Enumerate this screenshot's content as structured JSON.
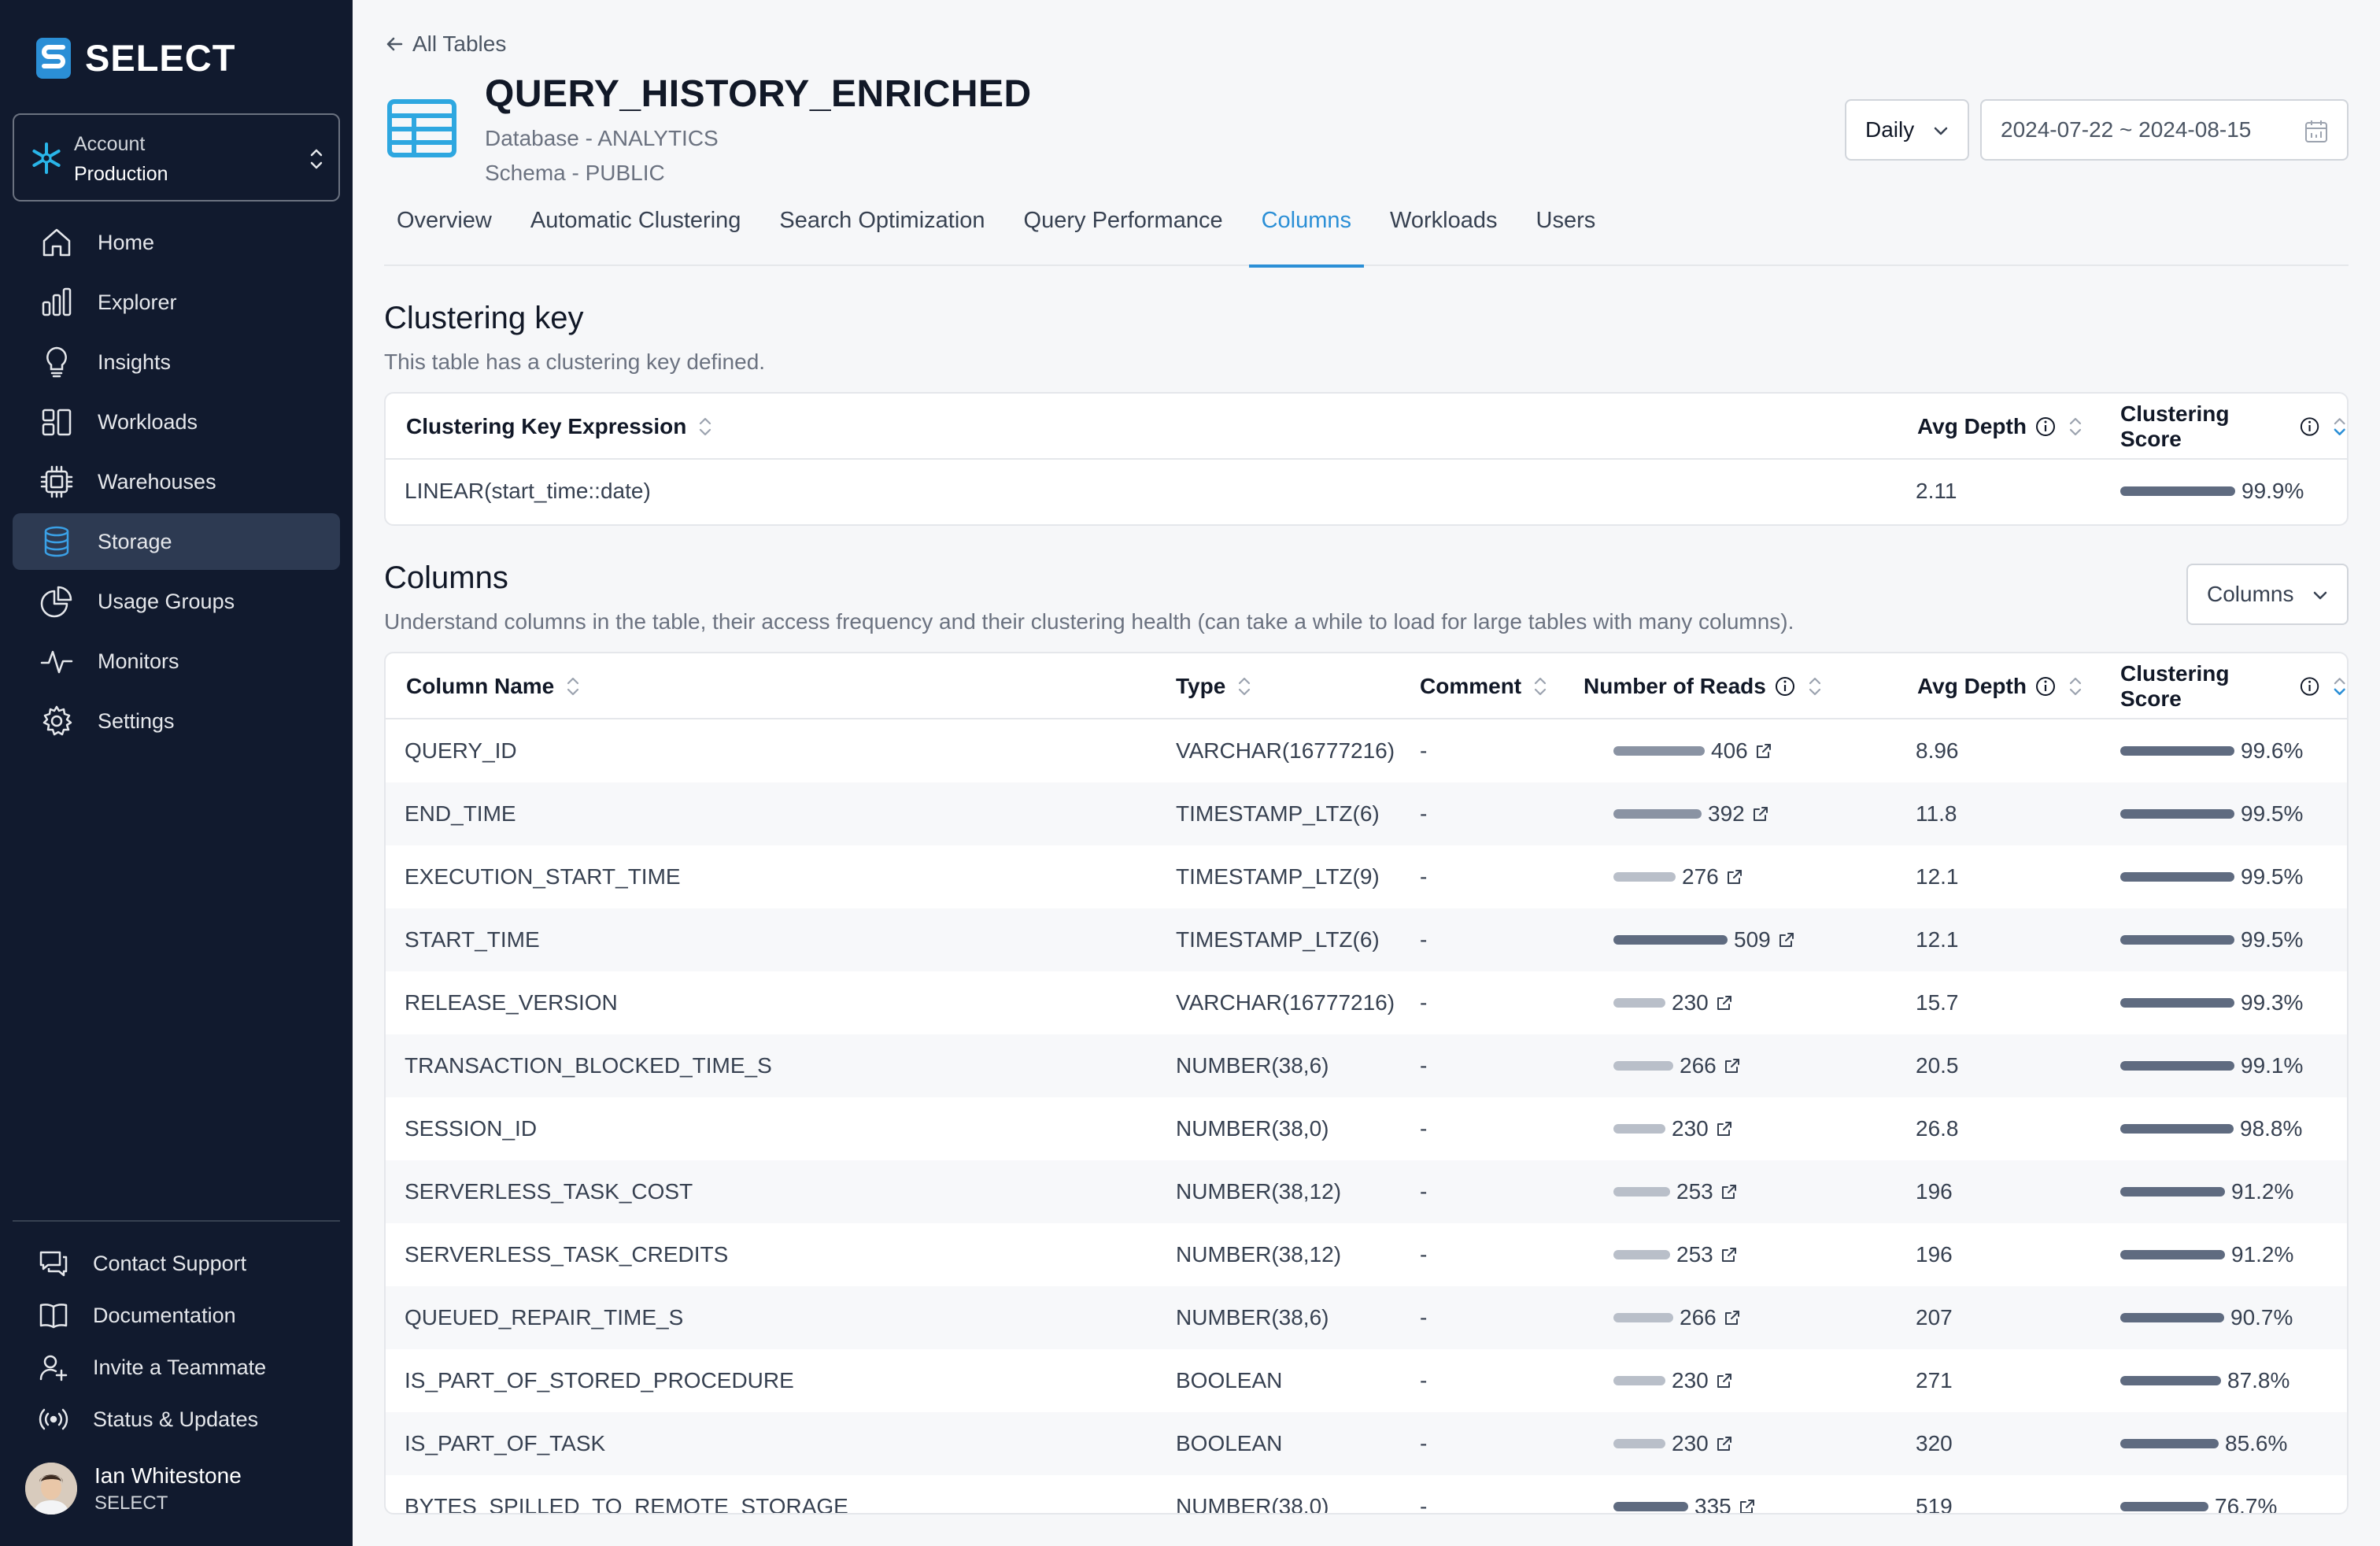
{
  "app": {
    "name": "SELECT"
  },
  "account": {
    "label": "Account",
    "value": "Production"
  },
  "nav": [
    {
      "label": "Home",
      "icon": "home-icon"
    },
    {
      "label": "Explorer",
      "icon": "bar-chart-icon"
    },
    {
      "label": "Insights",
      "icon": "lightbulb-icon"
    },
    {
      "label": "Workloads",
      "icon": "layout-icon"
    },
    {
      "label": "Warehouses",
      "icon": "chip-icon"
    },
    {
      "label": "Storage",
      "icon": "database-icon",
      "active": true
    },
    {
      "label": "Usage Groups",
      "icon": "pie-chart-icon"
    },
    {
      "label": "Monitors",
      "icon": "activity-icon"
    },
    {
      "label": "Settings",
      "icon": "gear-icon"
    }
  ],
  "bottom_nav": [
    {
      "label": "Contact Support",
      "icon": "chat-icon"
    },
    {
      "label": "Documentation",
      "icon": "book-icon"
    },
    {
      "label": "Invite a Teammate",
      "icon": "user-plus-icon"
    },
    {
      "label": "Status & Updates",
      "icon": "broadcast-icon"
    }
  ],
  "user": {
    "name": "Ian Whitestone",
    "org": "SELECT"
  },
  "header": {
    "back_label": "All Tables",
    "title": "QUERY_HISTORY_ENRICHED",
    "database": "Database - ANALYTICS",
    "schema": "Schema - PUBLIC",
    "frequency": "Daily",
    "date_range": "2024-07-22 ~ 2024-08-15"
  },
  "tabs": [
    {
      "label": "Overview"
    },
    {
      "label": "Automatic Clustering"
    },
    {
      "label": "Search Optimization"
    },
    {
      "label": "Query Performance"
    },
    {
      "label": "Columns",
      "active": true
    },
    {
      "label": "Workloads"
    },
    {
      "label": "Users"
    }
  ],
  "clustering": {
    "title": "Clustering key",
    "description": "This table has a clustering key defined.",
    "headers": {
      "expression": "Clustering Key Expression",
      "avg_depth": "Avg Depth",
      "score": "Clustering Score"
    },
    "rows": [
      {
        "expression": "LINEAR(start_time::date)",
        "avg_depth": "2.11",
        "score": "99.9%",
        "score_value": 99.9
      }
    ]
  },
  "columns_section": {
    "title": "Columns",
    "description": "Understand columns in the table, their access frequency and their clustering health (can take a while to load for large tables with many columns).",
    "selector_label": "Columns",
    "headers": {
      "name": "Column Name",
      "type": "Type",
      "comment": "Comment",
      "reads": "Number of Reads",
      "avg_depth": "Avg Depth",
      "score": "Clustering Score"
    },
    "rows": [
      {
        "name": "QUERY_ID",
        "type": "VARCHAR(16777216)",
        "comment": "-",
        "reads": "406",
        "reads_value": 406,
        "avg_depth": "8.96",
        "score": "99.6%",
        "score_value": 99.6
      },
      {
        "name": "END_TIME",
        "type": "TIMESTAMP_LTZ(6)",
        "comment": "-",
        "reads": "392",
        "reads_value": 392,
        "avg_depth": "11.8",
        "score": "99.5%",
        "score_value": 99.5
      },
      {
        "name": "EXECUTION_START_TIME",
        "type": "TIMESTAMP_LTZ(9)",
        "comment": "-",
        "reads": "276",
        "reads_value": 276,
        "avg_depth": "12.1",
        "score": "99.5%",
        "score_value": 99.5
      },
      {
        "name": "START_TIME",
        "type": "TIMESTAMP_LTZ(6)",
        "comment": "-",
        "reads": "509",
        "reads_value": 509,
        "avg_depth": "12.1",
        "score": "99.5%",
        "score_value": 99.5
      },
      {
        "name": "RELEASE_VERSION",
        "type": "VARCHAR(16777216)",
        "comment": "-",
        "reads": "230",
        "reads_value": 230,
        "avg_depth": "15.7",
        "score": "99.3%",
        "score_value": 99.3
      },
      {
        "name": "TRANSACTION_BLOCKED_TIME_S",
        "type": "NUMBER(38,6)",
        "comment": "-",
        "reads": "266",
        "reads_value": 266,
        "avg_depth": "20.5",
        "score": "99.1%",
        "score_value": 99.1
      },
      {
        "name": "SESSION_ID",
        "type": "NUMBER(38,0)",
        "comment": "-",
        "reads": "230",
        "reads_value": 230,
        "avg_depth": "26.8",
        "score": "98.8%",
        "score_value": 98.8
      },
      {
        "name": "SERVERLESS_TASK_COST",
        "type": "NUMBER(38,12)",
        "comment": "-",
        "reads": "253",
        "reads_value": 253,
        "avg_depth": "196",
        "score": "91.2%",
        "score_value": 91.2
      },
      {
        "name": "SERVERLESS_TASK_CREDITS",
        "type": "NUMBER(38,12)",
        "comment": "-",
        "reads": "253",
        "reads_value": 253,
        "avg_depth": "196",
        "score": "91.2%",
        "score_value": 91.2
      },
      {
        "name": "QUEUED_REPAIR_TIME_S",
        "type": "NUMBER(38,6)",
        "comment": "-",
        "reads": "266",
        "reads_value": 266,
        "avg_depth": "207",
        "score": "90.7%",
        "score_value": 90.7
      },
      {
        "name": "IS_PART_OF_STORED_PROCEDURE",
        "type": "BOOLEAN",
        "comment": "-",
        "reads": "230",
        "reads_value": 230,
        "avg_depth": "271",
        "score": "87.8%",
        "score_value": 87.8
      },
      {
        "name": "IS_PART_OF_TASK",
        "type": "BOOLEAN",
        "comment": "-",
        "reads": "230",
        "reads_value": 230,
        "avg_depth": "320",
        "score": "85.6%",
        "score_value": 85.6
      },
      {
        "name": "BYTES_SPILLED_TO_REMOTE_STORAGE",
        "type": "NUMBER(38,0)",
        "comment": "-",
        "reads": "335",
        "reads_value": 335,
        "avg_depth": "519",
        "score": "76.7%",
        "score_value": 76.7
      }
    ]
  },
  "colors": {
    "sidebar_bg": "#111a2e",
    "accent": "#2b8fd6",
    "bar_dark": "#5f6b80",
    "bar_light": "#b9bfc9"
  }
}
